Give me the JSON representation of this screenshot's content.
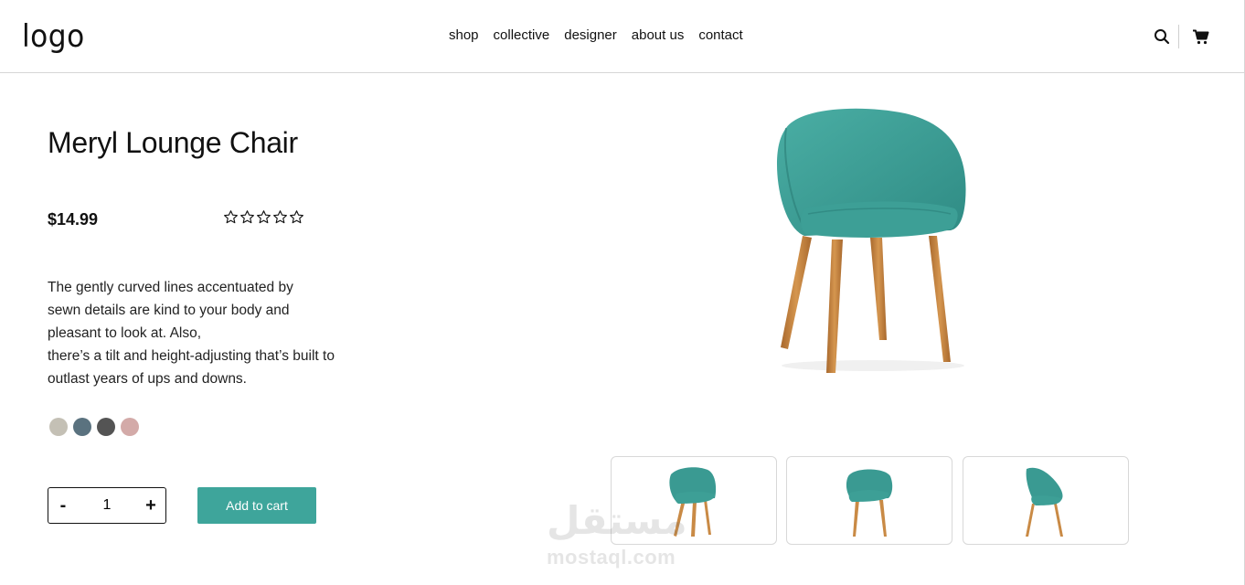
{
  "header": {
    "logo": "logo",
    "nav": [
      "shop",
      "collective",
      "designer",
      "about us",
      "contact"
    ],
    "icons": [
      "search-icon",
      "cart-icon"
    ]
  },
  "product": {
    "title": "Meryl Lounge Chair",
    "price": "$14.99",
    "rating": {
      "filled": 0,
      "max": 5
    },
    "description": [
      "The gently curved lines accentuated by",
      "sewn details are kind to your body and",
      "pleasant to look at. Also,",
      "there’s a tilt and height-adjusting that’s built to",
      "outlast years of ups and downs."
    ],
    "colors": [
      "#c4c0b5",
      "#5a727f",
      "#545454",
      "#d3aaa8"
    ],
    "quantity": "1",
    "quantity_minus": "-",
    "quantity_plus": "+",
    "add_to_cart": "Add to cart"
  },
  "theme": {
    "accent": "#3ea59b",
    "chair_seat": "#3a9a92",
    "chair_legs": "#c98a45"
  },
  "watermark": {
    "arabic": "مستقل",
    "latin": "mostaql.com"
  }
}
